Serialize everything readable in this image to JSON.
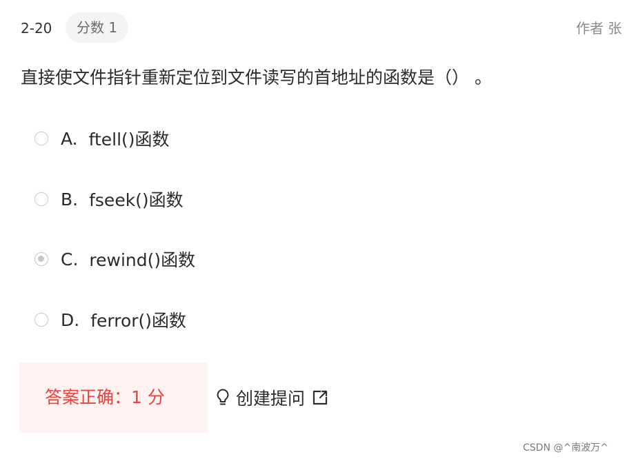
{
  "header": {
    "number": "2-20",
    "score_label": "分数 1",
    "author": "作者 张"
  },
  "question": {
    "text": "直接使文件指针重新定位到文件读写的首地址的函数是（）  。"
  },
  "options": [
    {
      "letter": "A.",
      "text": "ftell()函数",
      "checked": false
    },
    {
      "letter": "B.",
      "text": "fseek()函数",
      "checked": false
    },
    {
      "letter": "C.",
      "text": "rewind()函数",
      "checked": true
    },
    {
      "letter": "D.",
      "text": "ferror()函数",
      "checked": false
    }
  ],
  "result": {
    "text": "答案正确：1 分",
    "color": "#f0403b",
    "background": "#fff3f2"
  },
  "ask": {
    "label": "创建提问",
    "left_icon": "lightbulb-icon",
    "right_icon": "external-link-icon"
  },
  "watermark": {
    "text": "CSDN @^南波万^"
  }
}
